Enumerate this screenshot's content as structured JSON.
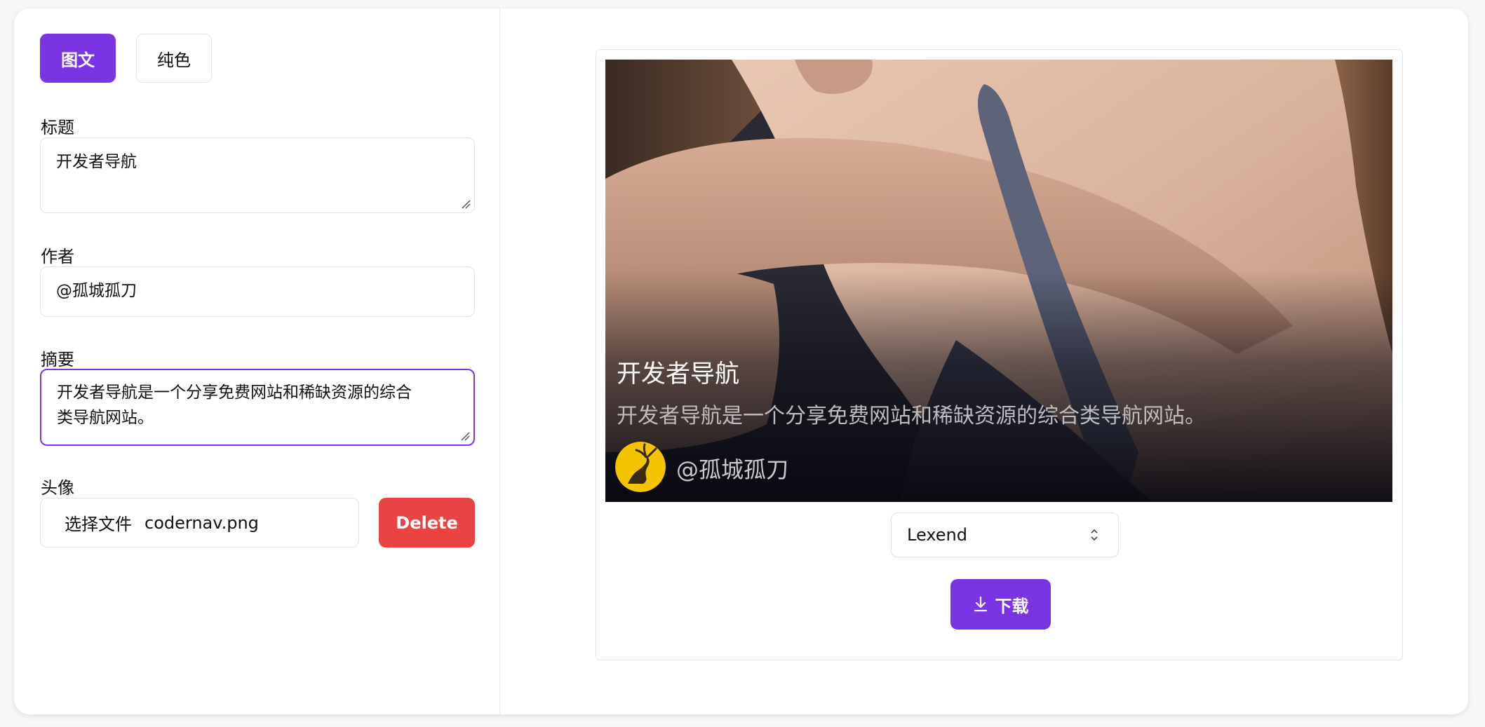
{
  "tabs": [
    {
      "label": "图文",
      "active": true
    },
    {
      "label": "纯色",
      "active": false
    }
  ],
  "form": {
    "title_label": "标题",
    "title_value": "开发者导航",
    "author_label": "作者",
    "author_value": "@孤城孤刀",
    "summary_label": "摘要",
    "summary_line1": "开发者导航是一个分享免费网站和稀缺资源的综合",
    "summary_line2": "类导航网站。",
    "avatar_label": "头像",
    "file_button": "选择文件",
    "file_name": "codernav.png",
    "delete_label": "Delete"
  },
  "preview": {
    "title": "开发者导航",
    "summary": "开发者导航是一个分享免费网站和稀缺资源的综合类导航网站。",
    "author": "@孤城孤刀",
    "avatar_icon": "deer-logo-icon",
    "background": "photo of a person embracing"
  },
  "controls": {
    "font_value": "Lexend",
    "download_label": "下载",
    "download_icon": "download-icon"
  },
  "colors": {
    "accent": "#7a34e4",
    "danger": "#ea4343"
  }
}
